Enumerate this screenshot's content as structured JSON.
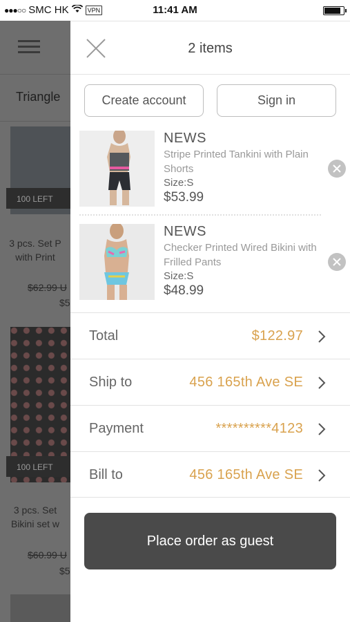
{
  "status_bar": {
    "signal": "●●●○○",
    "carrier": "SMC HK",
    "wifi_icon": "wifi-icon",
    "vpn": "VPN",
    "time": "11:41 AM",
    "battery_level": 0.85
  },
  "background_app": {
    "filter_label": "Triangle",
    "products": [
      {
        "badge": "100 LEFT",
        "title": "3 pcs. Set P\nwith Print",
        "old_price": "$62.99 U",
        "price": "$5"
      },
      {
        "badge": "100 LEFT",
        "title": "3 pcs. Set\nBikini set w",
        "old_price": "$60.99 U",
        "price": "$5"
      }
    ]
  },
  "cart": {
    "title": "2 items",
    "create_account": "Create account",
    "sign_in": "Sign in",
    "items": [
      {
        "brand": "NEWS",
        "name": "Stripe Printed Tankini with Plain Shorts",
        "size": "Size:S",
        "price": "$53.99"
      },
      {
        "brand": "NEWS",
        "name": "Checker Printed Wired Bikini with Frilled Pants",
        "size": "Size:S",
        "price": "$48.99"
      }
    ],
    "summary": [
      {
        "label": "Total",
        "value": "$122.97"
      },
      {
        "label": "Ship to",
        "value": "456 165th Ave SE"
      },
      {
        "label": "Payment",
        "value": "**********4123"
      },
      {
        "label": "Bill to",
        "value": "456 165th Ave SE"
      }
    ],
    "place_order": "Place order as guest"
  },
  "colors": {
    "accent": "#d9a24e",
    "order_button": "#4a4a4a",
    "overlay": "#6e6e6e"
  }
}
